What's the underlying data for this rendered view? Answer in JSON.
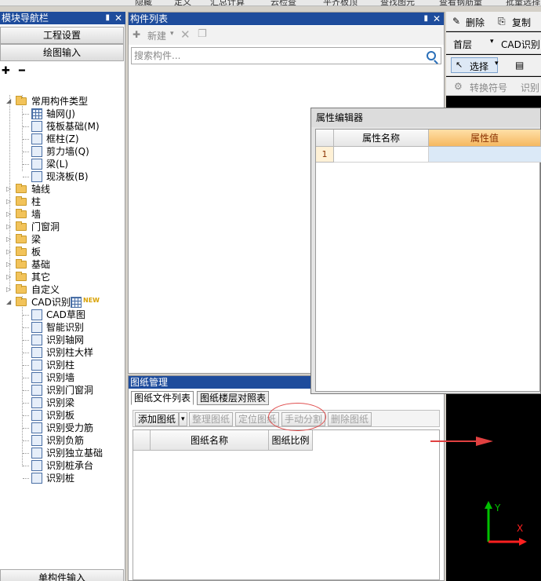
{
  "top_toolbar": {
    "items": [
      "隐藏",
      "定义",
      "汇总计算",
      "云检查",
      "平齐板顶",
      "查找图元",
      "查看钢筋量",
      "批量选择"
    ]
  },
  "left_panel": {
    "title": "模块导航栏",
    "section_buttons": [
      "工程设置",
      "绘图输入"
    ],
    "tree": {
      "common_folder": "常用构件类型",
      "common_items": [
        "轴网(J)",
        "筏板基础(M)",
        "框柱(Z)",
        "剪力墙(Q)",
        "梁(L)",
        "现浇板(B)"
      ],
      "folders": [
        "轴线",
        "柱",
        "墙",
        "门窗洞",
        "梁",
        "板",
        "基础",
        "其它",
        "自定义"
      ],
      "cad_folder": "CAD识别",
      "cad_badge": "NEW",
      "cad_items": [
        "CAD草图",
        "智能识别",
        "识别轴网",
        "识别柱大样",
        "识别柱",
        "识别墙",
        "识别门窗洞",
        "识别梁",
        "识别板",
        "识别受力筋",
        "识别负筋",
        "识别独立基础",
        "识别桩承台",
        "识别桩"
      ]
    },
    "bottom_button": "单构件输入"
  },
  "component_list": {
    "title": "构件列表",
    "new_label": "新建",
    "search_placeholder": "搜索构件..."
  },
  "drawing_management": {
    "title": "图纸管理",
    "tabs": [
      "图纸文件列表",
      "图纸楼层对照表"
    ],
    "buttons": [
      "添加图纸",
      "整理图纸",
      "定位图纸",
      "手动分割",
      "删除图纸"
    ],
    "columns": [
      "图纸名称",
      "图纸比例"
    ]
  },
  "property_editor": {
    "title": "属性编辑器",
    "columns": [
      "属性名称",
      "属性值"
    ],
    "rows": [
      {
        "index": "1",
        "name": "",
        "value": ""
      }
    ]
  },
  "right_toolbar": {
    "delete_label": "删除",
    "copy_label": "复制",
    "floor_value": "首层",
    "cad_label": "CAD识别",
    "select_label": "选择",
    "convert_label": "转换符号",
    "recognize_label": "识别"
  },
  "axis": {
    "y_label": "Y",
    "x_label": "X"
  },
  "colors": {
    "title_bar": "#1e4c9c",
    "highlight_header": "#f5b860",
    "annotation_red": "#e04040",
    "axis_green": "#00c000",
    "axis_red": "#ff2020"
  }
}
